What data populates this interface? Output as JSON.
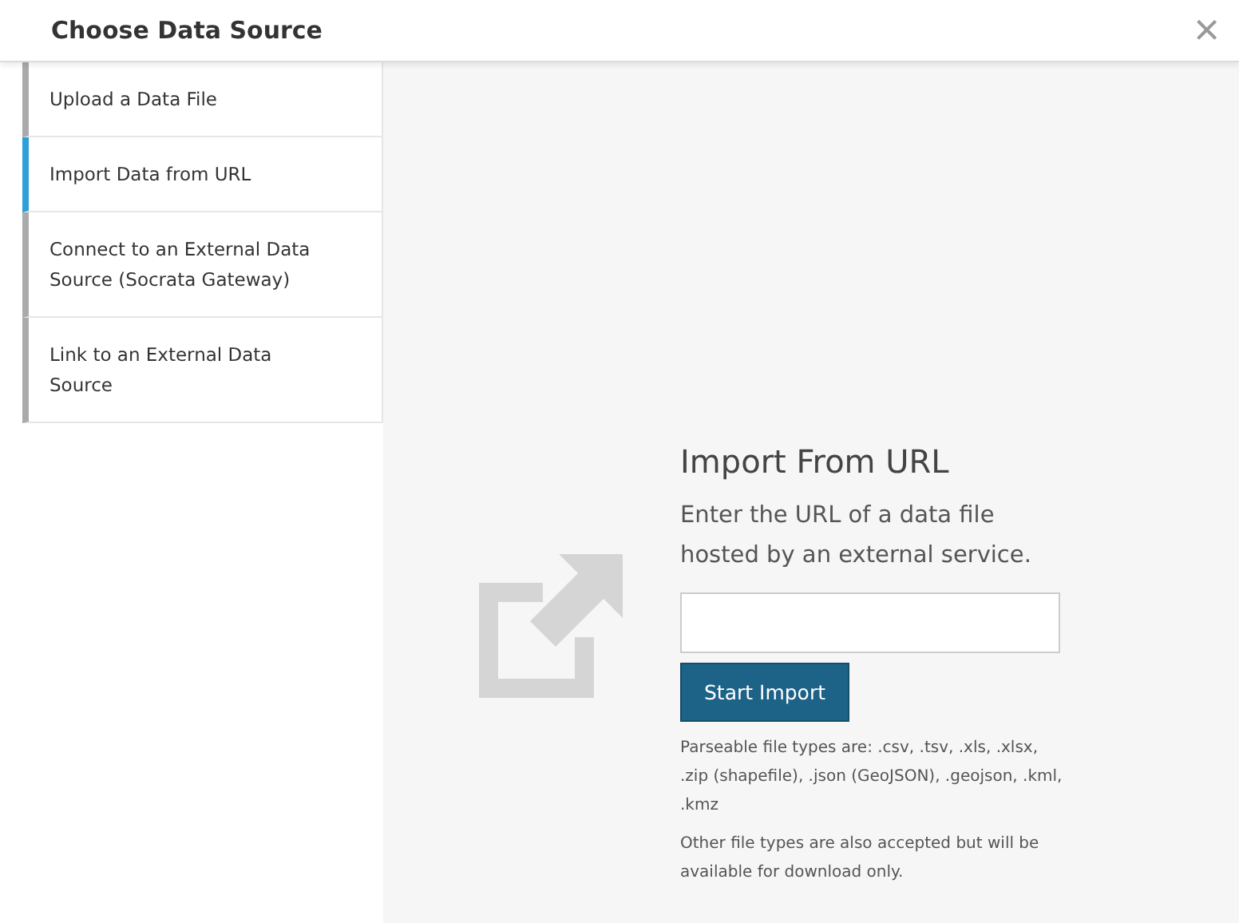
{
  "dialog": {
    "title": "Choose Data Source",
    "close": "×"
  },
  "sidebar": {
    "items": [
      {
        "label": "Upload a Data File",
        "selected": false
      },
      {
        "label": "Import Data from URL",
        "selected": true
      },
      {
        "label": "Connect to an External Data Source (Socrata Gateway)",
        "selected": false
      },
      {
        "label": "Link to an External Data Source",
        "selected": false
      }
    ]
  },
  "panel": {
    "heading": "Import From URL",
    "instructions": "Enter the URL of a data file hosted by an external service.",
    "button": "Start Import",
    "file_types": "Parseable file types are: .csv, .tsv, .xls, .xlsx, .zip (shapefile), .json (GeoJSON), .geojson, .kml, .kmz",
    "note": "Other file types are also accepted but will be available for download only."
  }
}
